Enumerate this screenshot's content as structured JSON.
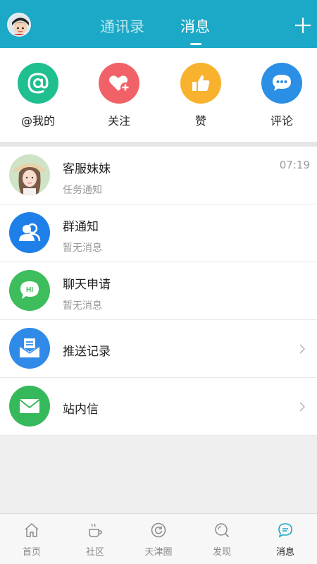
{
  "header": {
    "tabs": [
      {
        "label": "通讯录",
        "active": false
      },
      {
        "label": "消息",
        "active": true
      }
    ],
    "accent_color": "#1ba9c7"
  },
  "quick_actions": [
    {
      "label": "@我的",
      "icon": "at-icon",
      "color": "#1fbf8f"
    },
    {
      "label": "关注",
      "icon": "heart-plus-icon",
      "color": "#f16268"
    },
    {
      "label": "赞",
      "icon": "thumbs-up-icon",
      "color": "#f8b22d"
    },
    {
      "label": "评论",
      "icon": "comment-icon",
      "color": "#2b8fe5"
    }
  ],
  "messages": [
    {
      "title": "客服妹妹",
      "subtitle": "任务通知",
      "time": "07:19",
      "icon": "avatar-photo"
    },
    {
      "title": "群通知",
      "subtitle": "暂无消息",
      "icon": "group-icon",
      "color": "#1f7fe9"
    },
    {
      "title": "聊天申请",
      "subtitle": "暂无消息",
      "icon": "hi-chat-icon",
      "icon_text": "HI",
      "color": "#3dbd5b"
    },
    {
      "title": "推送记录",
      "icon": "inbox-icon",
      "color": "#2f8ae8"
    },
    {
      "title": "站内信",
      "icon": "envelope-icon",
      "color": "#36b95a"
    }
  ],
  "bottom_nav": [
    {
      "label": "首页",
      "icon": "home-icon",
      "active": false
    },
    {
      "label": "社区",
      "icon": "cup-icon",
      "active": false
    },
    {
      "label": "天津圈",
      "icon": "refresh-circle-icon",
      "active": false
    },
    {
      "label": "发现",
      "icon": "search-icon",
      "active": false
    },
    {
      "label": "消息",
      "icon": "message-icon",
      "active": true
    }
  ]
}
